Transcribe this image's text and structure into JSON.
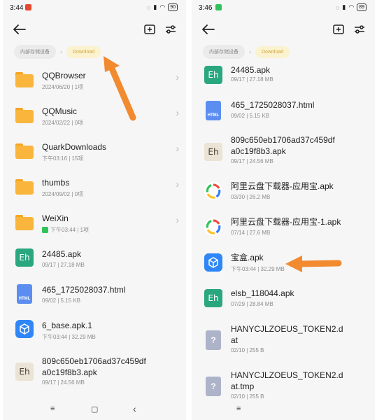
{
  "left": {
    "status": {
      "time": "3:44",
      "battery": "90"
    },
    "breadcrumb": {
      "root": "内部存储设备",
      "current": "Download"
    },
    "items": [
      {
        "name": "QQBrowser",
        "meta": "2024/06/20 | 1项",
        "kind": "folder"
      },
      {
        "name": "QQMusic",
        "meta": "2024/02/22 | 0项",
        "kind": "folder"
      },
      {
        "name": "QuarkDownloads",
        "meta": "下午03:16 | 15项",
        "kind": "folder"
      },
      {
        "name": "thumbs",
        "meta": "2024/09/02 | 0项",
        "kind": "folder"
      },
      {
        "name": "WeiXin",
        "meta": "下午03:44 | 1项",
        "kind": "folder"
      },
      {
        "name": "24485.apk",
        "meta": "09/17 | 27.18 MB",
        "kind": "eh-green"
      },
      {
        "name": "465_1725028037.html",
        "meta": "09/02 | 5.15 KB",
        "kind": "html"
      },
      {
        "name": "6_base.apk.1",
        "meta": "下午03:44 | 32.29 MB",
        "kind": "box"
      },
      {
        "name_line1": "809c650eb1706ad37c459df",
        "name_line2": "a0c19f8b3.apk",
        "meta": "09/17 | 24.56 MB",
        "kind": "eh-beige"
      }
    ]
  },
  "right": {
    "status": {
      "time": "3:46",
      "battery": "89"
    },
    "breadcrumb": {
      "root": "内部存储设备",
      "current": "Download"
    },
    "items": [
      {
        "name": "24485.apk",
        "meta": "09/17 | 27.18 MB",
        "kind": "eh-green"
      },
      {
        "name": "465_1725028037.html",
        "meta": "09/02 | 5.15 KB",
        "kind": "html"
      },
      {
        "name_line1": "809c650eb1706ad37c459df",
        "name_line2": "a0c19f8b3.apk",
        "meta": "09/17 | 24.56 MB",
        "kind": "eh-beige"
      },
      {
        "name": "阿里云盘下载器-应用宝.apk",
        "meta": "03/30 | 26.2 MB",
        "kind": "ali"
      },
      {
        "name": "阿里云盘下载器-应用宝-1.apk",
        "meta": "07/14 | 27.6 MB",
        "kind": "ali"
      },
      {
        "name": "宝盒.apk",
        "meta": "下午03:44 | 32.29 MB",
        "kind": "box"
      },
      {
        "name": "elsb_118044.apk",
        "meta": "07/29 | 28.84 MB",
        "kind": "eh-green"
      },
      {
        "name_line1": "HANYCJLZOEUS_TOKEN2.d",
        "name_line2": "at",
        "meta": "02/10 | 255 B",
        "kind": "q"
      },
      {
        "name_line1": "HANYCJLZOEUS_TOKEN2.d",
        "name_line2": "at.tmp",
        "meta": "02/10 | 255 B",
        "kind": "q"
      }
    ]
  },
  "icons": {
    "back": "arrow-left",
    "new_folder": "plus-square",
    "filter": "sliders",
    "chevron": "chevron-right",
    "nav_menu": "≡",
    "nav_home": "▢",
    "nav_back": "‹",
    "chevron_glyph": "›",
    "breadcrumb_sep": "›",
    "eh_text": "Eh",
    "html_text": "HTML",
    "q_text": "?"
  },
  "colors": {
    "accent": "#d3a43b",
    "annotation_arrow": "#f28a30",
    "folder": "#f9b53c",
    "eh_green": "#2aa77f",
    "html_blue": "#5c8ef1",
    "box_blue": "#2f86f6",
    "q_gray": "#adb3c8"
  }
}
